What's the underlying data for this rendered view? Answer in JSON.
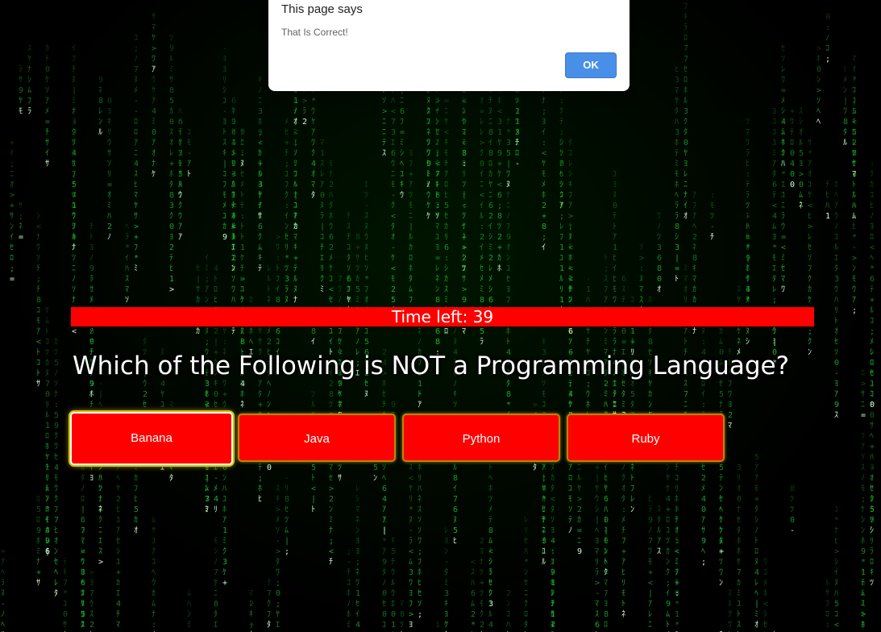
{
  "dialog": {
    "title": "This page says",
    "message": "That Is Correct!",
    "ok_label": "OK"
  },
  "quiz": {
    "timer_text": "Time left: 39",
    "question": "Which of the Following is NOT a Programming Language?",
    "answers": [
      {
        "label": "Banana",
        "selected": true
      },
      {
        "label": "Java",
        "selected": false
      },
      {
        "label": "Python",
        "selected": false
      },
      {
        "label": "Ruby",
        "selected": false
      }
    ]
  },
  "background": {
    "type": "matrix-digital-rain",
    "glyph_color": "#22dd33",
    "bright_glyph_color": "#ccffcc"
  },
  "colors": {
    "timer_bar": "#ff0000",
    "answer_button": "#ff0000",
    "dialog_ok": "#4a8fe7"
  }
}
